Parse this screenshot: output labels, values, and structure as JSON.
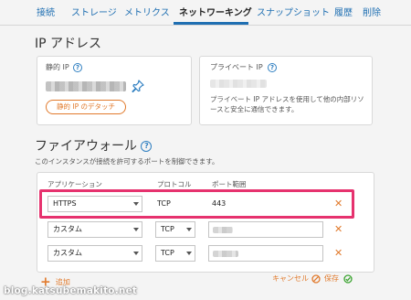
{
  "tabs": [
    {
      "label": "接続"
    },
    {
      "label": "ストレージ"
    },
    {
      "label": "メトリクス"
    },
    {
      "label": "ネットワーキング",
      "active": true
    },
    {
      "label": "スナップショット"
    },
    {
      "label": "履歴"
    },
    {
      "label": "削除"
    }
  ],
  "ip_section": {
    "title": "IP アドレス",
    "static_ip_label": "静的 IP",
    "detach_button": "静的 IP のデタッチ",
    "private_ip_label": "プライベート IP",
    "private_ip_desc": "プライベート IP アドレスを使用して他の内部リソースと安全に通信できます。"
  },
  "firewall": {
    "title": "ファイアウォール",
    "description": "このインスタンスが接続を許可するポートを制御できます。",
    "columns": [
      "アプリケーション",
      "プロトコル",
      "ポート範囲"
    ],
    "rows": [
      {
        "application": "HTTPS",
        "protocol": "TCP",
        "port": "443"
      },
      {
        "application": "カスタム",
        "protocol": "TCP",
        "port": ""
      },
      {
        "application": "カスタム",
        "protocol": "TCP",
        "port": ""
      }
    ],
    "add_label": "追加",
    "cancel_label": "キャンセル",
    "save_label": "保存"
  },
  "icons": {
    "help": "help-circle-icon",
    "pin": "pin-icon",
    "remove": "close-icon",
    "add": "plus-icon",
    "cancel": "cancel-circle-icon",
    "save": "check-circle-icon"
  },
  "colors": {
    "link": "#1f6fb2",
    "accent": "#e17a2c",
    "highlight": "#e6326e",
    "save_green": "#3aa32f"
  },
  "watermark": "blog.katsubemakito.net",
  "help_glyph": "?"
}
